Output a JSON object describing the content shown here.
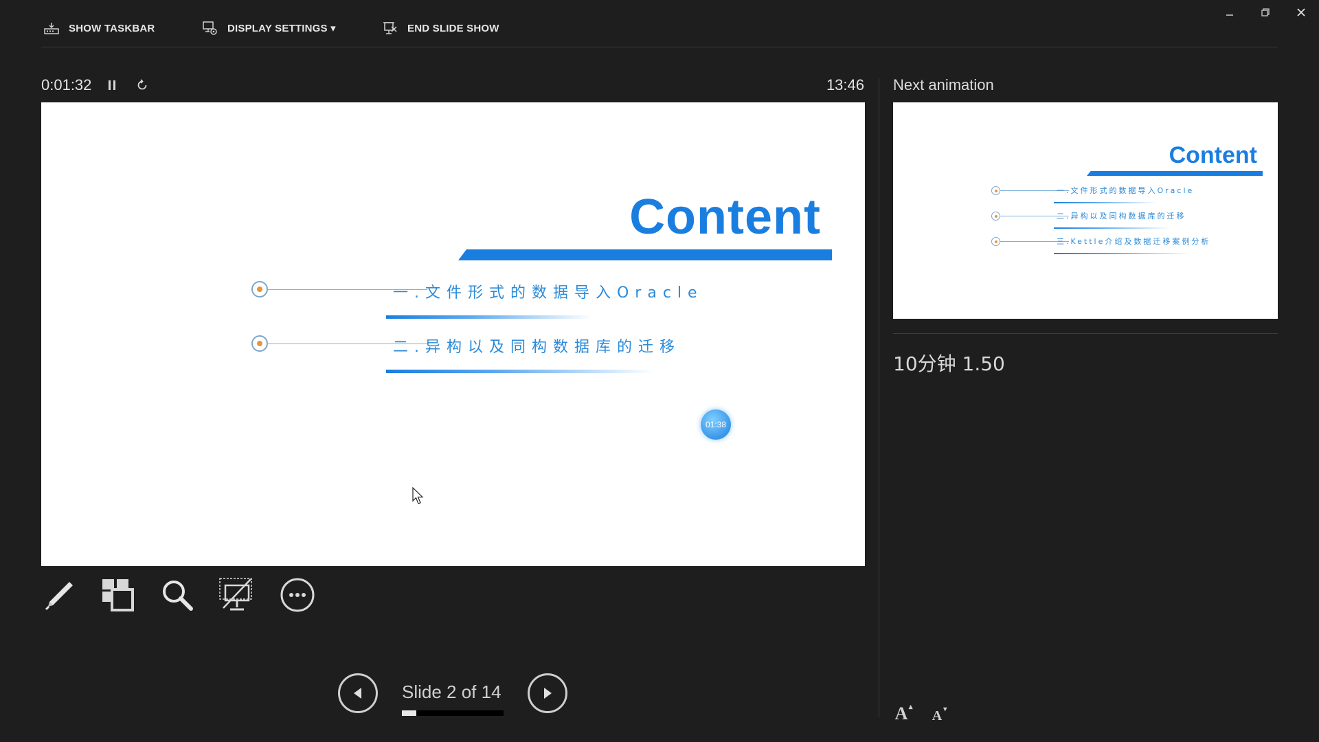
{
  "toolbar": {
    "show_taskbar": "SHOW TASKBAR",
    "display_settings": "DISPLAY SETTINGS ▾",
    "end_slide_show": "END SLIDE SHOW"
  },
  "timer": {
    "elapsed": "0:01:32",
    "clock": "13:46"
  },
  "current_slide": {
    "title": "Content",
    "items": [
      "一.文件形式的数据导入Oracle",
      "二.异构以及同构数据库的迁移"
    ],
    "timer_badge": "01:38"
  },
  "navigation": {
    "slide_counter": "Slide 2 of 14",
    "current": 2,
    "total": 14
  },
  "next_panel": {
    "label": "Next animation",
    "title": "Content",
    "items": [
      "一.文件形式的数据导入Oracle",
      "二.异构以及同构数据库的迁移",
      "三.Kettle介绍及数据迁移案例分析"
    ]
  },
  "notes": {
    "text": "10分钟   1.50"
  },
  "font_controls": {
    "increase": "A",
    "decrease": "A"
  },
  "icons": {
    "toolbar": [
      "taskbar-icon",
      "display-settings-icon",
      "end-show-icon"
    ],
    "tools": [
      "pen-icon",
      "see-all-slides-icon",
      "zoom-icon",
      "black-screen-icon",
      "more-options-icon"
    ],
    "window": [
      "minimize-icon",
      "restore-icon",
      "close-icon"
    ]
  },
  "colors": {
    "background": "#1e1e1e",
    "accent": "#1a7ee0",
    "bullet": "#e8963a"
  }
}
